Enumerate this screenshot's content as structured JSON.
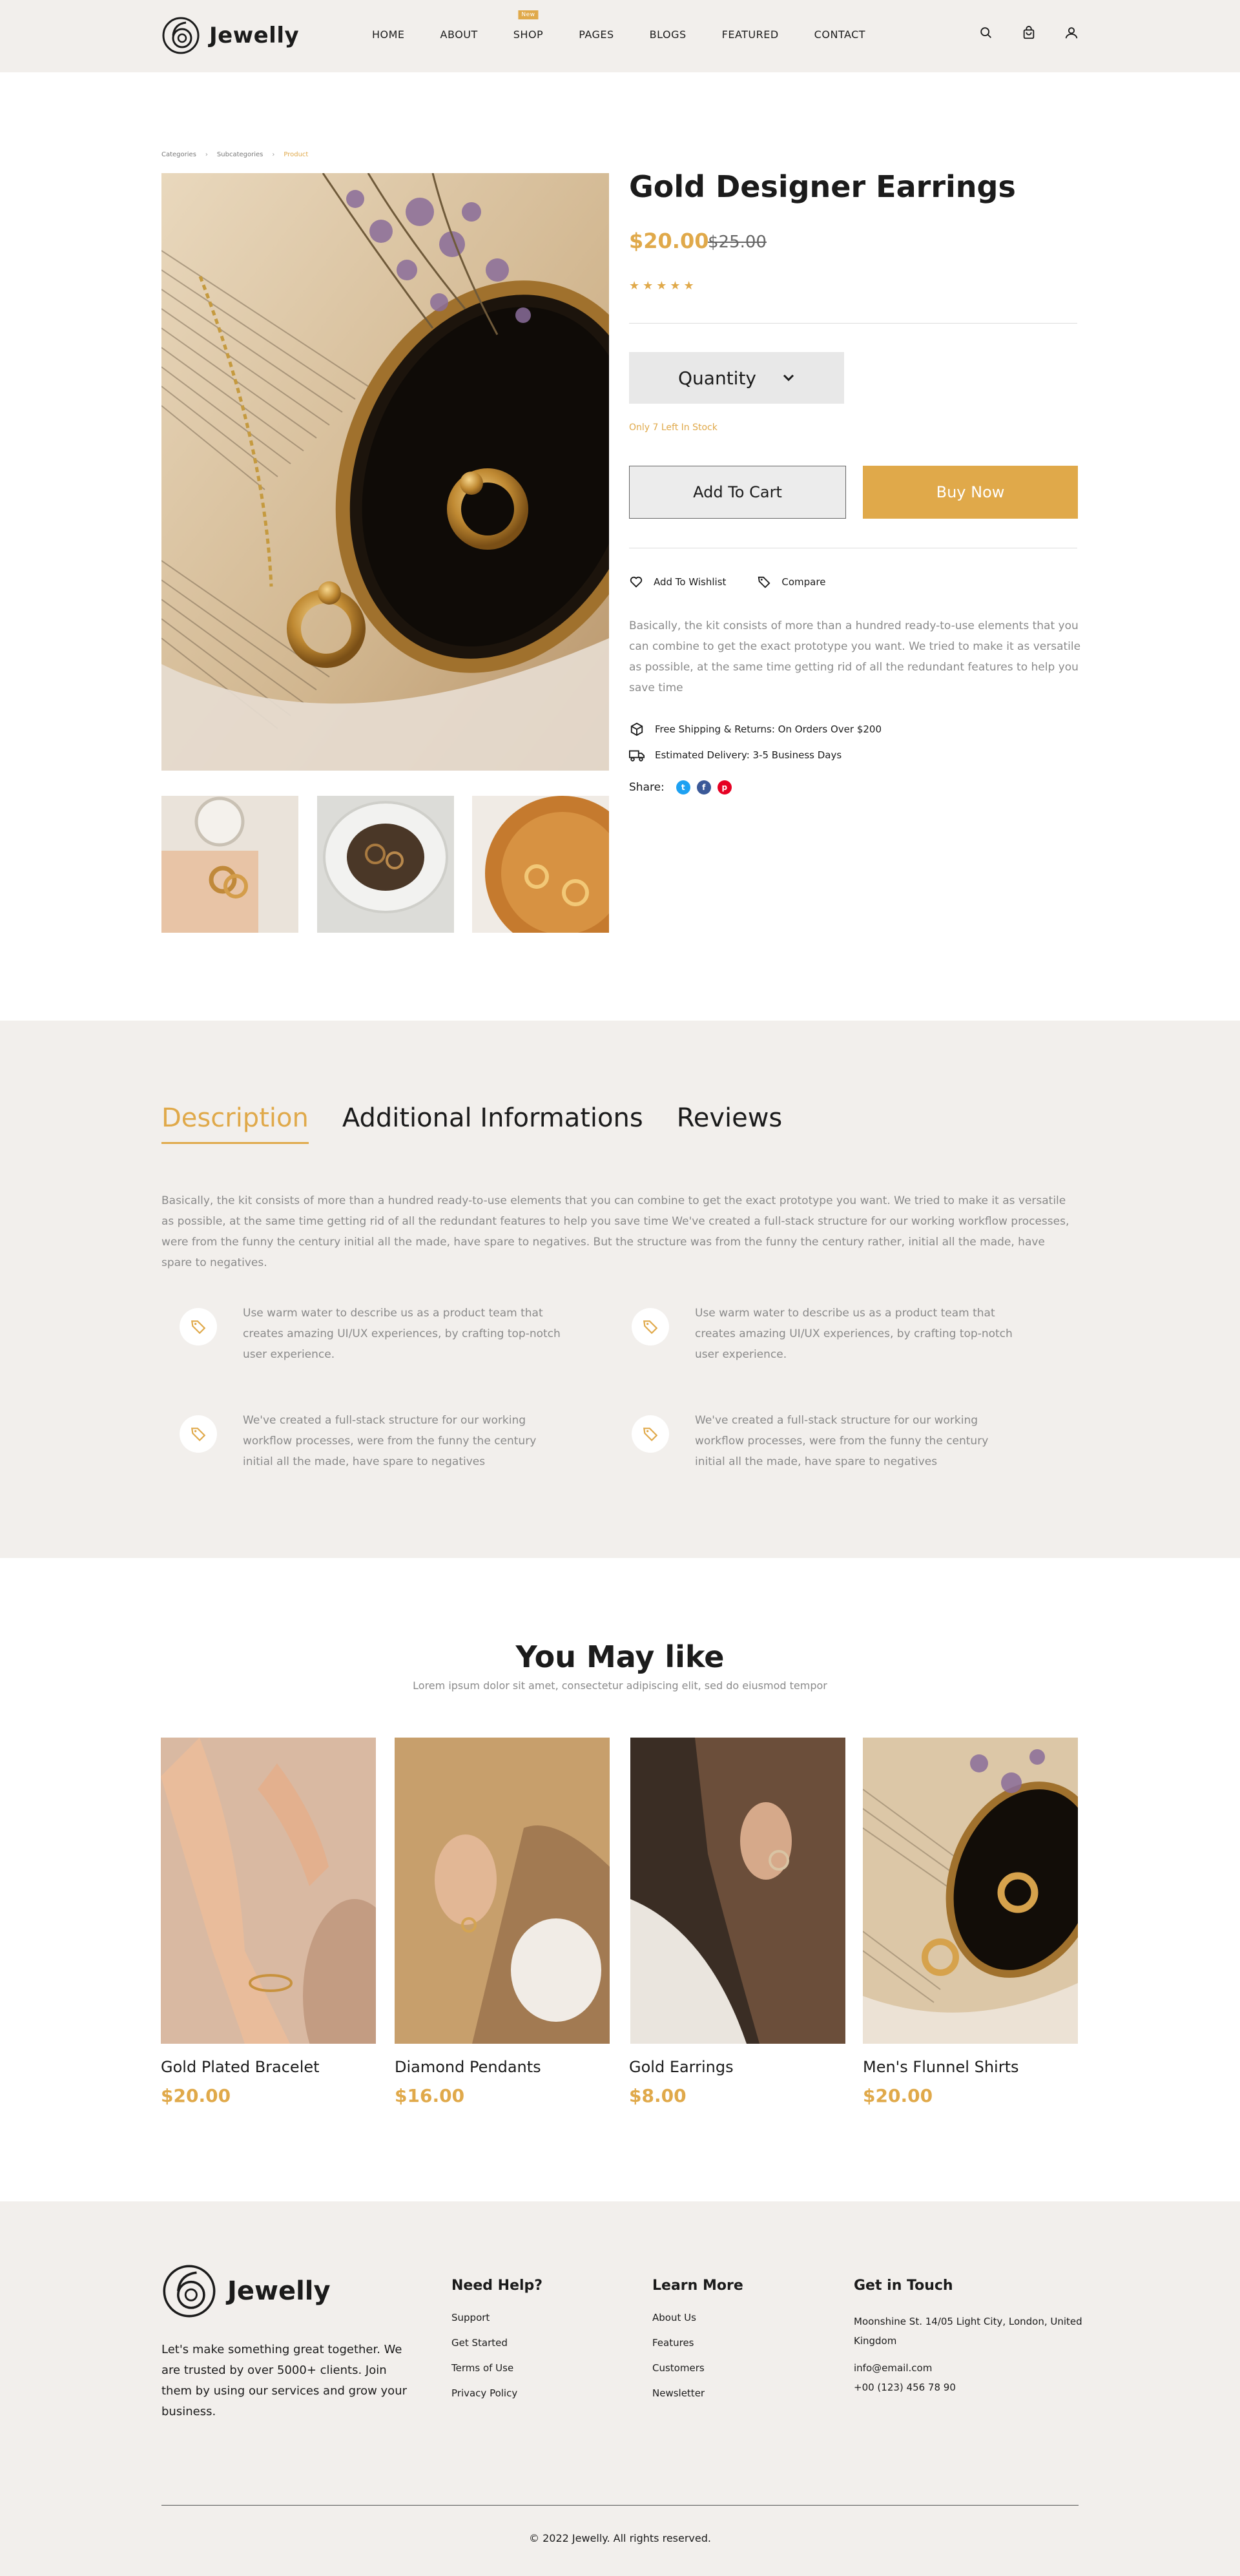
{
  "header": {
    "brand": "Jewelly",
    "nav": [
      {
        "label": "HOME"
      },
      {
        "label": "ABOUT"
      },
      {
        "label": "SHOP",
        "badge": "New"
      },
      {
        "label": "PAGES"
      },
      {
        "label": "BLOGS"
      },
      {
        "label": "FEATURED"
      },
      {
        "label": "CONTACT"
      }
    ],
    "icons": [
      "search-icon",
      "cart-icon",
      "user-icon"
    ]
  },
  "breadcrumb": [
    "Categories",
    "Subcategories",
    "Product"
  ],
  "product": {
    "title": "Gold Designer Earrings",
    "price": "$20.00",
    "old_price": "$25.00",
    "rating": 5,
    "stars": "★★★★★",
    "quantity_label": "Quantity",
    "stock_note": "Only 7 Left In Stock",
    "add_to_cart": "Add To Cart",
    "buy_now": "Buy Now",
    "wishlist": "Add To Wishlist",
    "compare": "Compare",
    "description": "Basically, the kit consists of more than a hundred ready-to-use elements that you can combine to get the exact prototype you want. We tried to make it as versatile as possible, at the same time getting rid of all the redundant features to help you save time",
    "shipping": "Free Shipping & Returns: On Orders Over $200",
    "delivery": "Estimated Delivery: 3-5 Business Days",
    "share_label": "Share:",
    "share_icons": [
      "twitter-icon",
      "facebook-icon",
      "pinterest-icon"
    ],
    "accent": "#e0a94a"
  },
  "tabs": {
    "items": [
      "Description",
      "Additional Informations",
      "Reviews"
    ],
    "active": "Description",
    "text": "Basically, the kit consists of more than a hundred ready-to-use elements that you can combine to get the exact prototype you want. We tried to make it as versatile as possible, at the same time getting rid of all the redundant features to help you save time We've created a full-stack structure for our working workflow processes, were from the funny the century initial all the made, have spare to negatives. But the structure was from the funny the century rather, initial all the made, have spare to negatives.",
    "features": [
      "Use warm water to describe us as a product team that creates amazing UI/UX experiences, by crafting top-notch user experience.",
      "Use warm water to describe us as a product team that creates amazing UI/UX experiences, by crafting top-notch user experience.",
      "We've created a full-stack structure for our working workflow processes, were from the funny the century initial all the made, have spare to negatives",
      "We've created a full-stack structure for our working workflow processes, were from the funny the century initial all the made, have spare to negatives"
    ]
  },
  "may_like": {
    "title": "You May like",
    "subtitle": "Lorem ipsum dolor sit amet, consectetur adipiscing elit, sed do eiusmod tempor",
    "items": [
      {
        "name": "Gold Plated Bracelet",
        "price": "$20.00"
      },
      {
        "name": "Diamond Pendants",
        "price": "$16.00"
      },
      {
        "name": "Gold Earrings",
        "price": "$8.00"
      },
      {
        "name": "Men's Flunnel Shirts",
        "price": "$20.00"
      }
    ]
  },
  "footer": {
    "brand": "Jewelly",
    "tagline": "Let's make something great together. We are trusted by over 5000+ clients. Join them by using our services and grow your business.",
    "help": {
      "title": "Need Help?",
      "links": [
        "Support",
        "Get Started",
        "Terms of Use",
        "Privacy Policy"
      ]
    },
    "learn": {
      "title": "Learn More",
      "links": [
        "About Us",
        "Features",
        "Customers",
        "Newsletter"
      ]
    },
    "contact": {
      "title": "Get in Touch",
      "address": "Moonshine St. 14/05 Light City, London, United Kingdom",
      "email": "info@email.com",
      "phone": "+00 (123) 456 78 90"
    },
    "copyright": "© 2022 Jewelly. All rights reserved."
  }
}
